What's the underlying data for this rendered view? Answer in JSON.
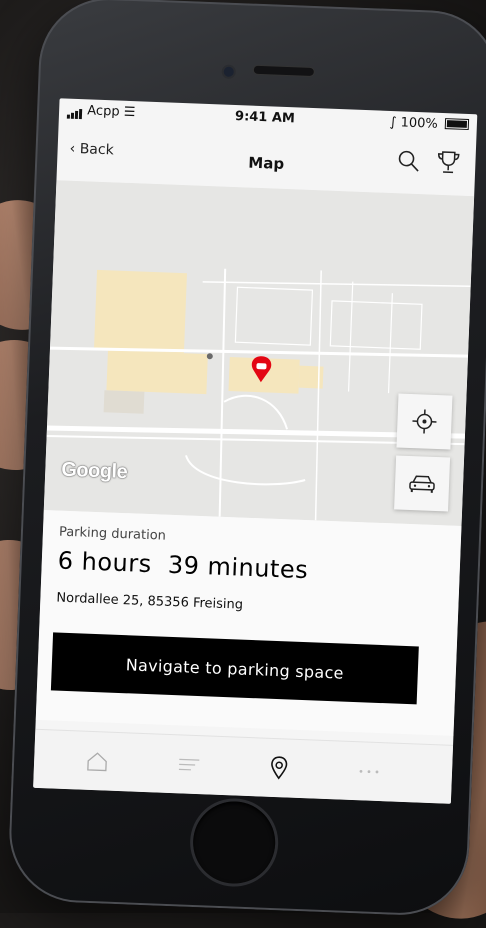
{
  "status_bar": {
    "carrier": "Acpp",
    "time": "9:41 AM",
    "battery": "100%"
  },
  "header": {
    "back_label": "Back",
    "title": "Map"
  },
  "map": {
    "provider_logo": "Google"
  },
  "parking": {
    "duration_label": "Parking duration",
    "duration_value": "6 hours  39 minutes",
    "address": "Nordallee 25, 85356 Freising"
  },
  "actions": {
    "navigate_label": "Navigate to parking space"
  },
  "tabbar": {
    "tabs": [
      {
        "icon": "home-icon",
        "active": false
      },
      {
        "icon": "list-icon",
        "active": false
      },
      {
        "icon": "map-pin-icon",
        "active": true
      },
      {
        "icon": "more-icon",
        "active": false
      }
    ]
  },
  "colors": {
    "accent": "#e30613",
    "button_bg": "#000000",
    "map_building": "#f5e6bd",
    "map_bg": "#e6e6e4"
  }
}
